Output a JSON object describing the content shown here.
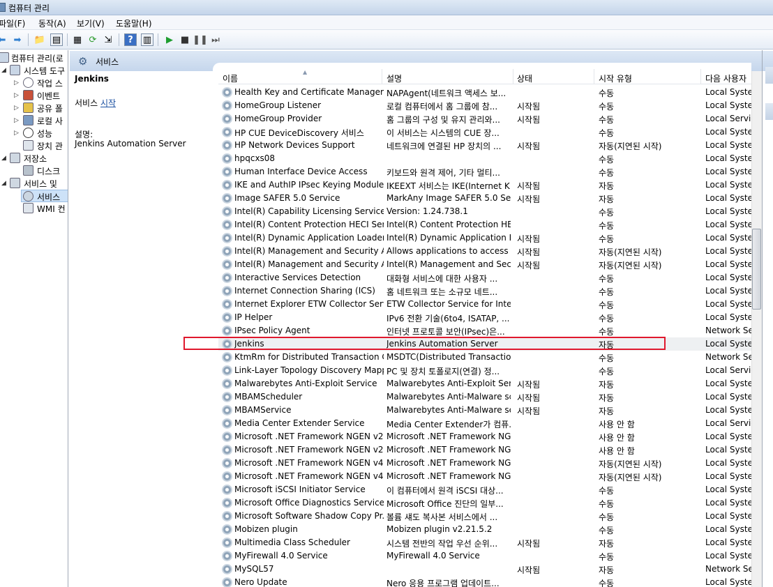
{
  "window": {
    "title": "컴퓨터 관리"
  },
  "menu": [
    "파일(F)",
    "동작(A)",
    "보기(V)",
    "도움말(H)"
  ],
  "tree": [
    {
      "label": "컴퓨터 관리(로",
      "icon": "computer-icon",
      "expanded": true
    },
    {
      "label": "시스템 도구",
      "icon": "tools-icon",
      "expanded": true
    },
    {
      "label": "작업 스",
      "icon": "clock-icon"
    },
    {
      "label": "이벤트",
      "icon": "event-viewer-icon"
    },
    {
      "label": "공유 폴",
      "icon": "shared-folder-icon"
    },
    {
      "label": "로컬 사",
      "icon": "users-icon"
    },
    {
      "label": "성능",
      "icon": "performance-icon"
    },
    {
      "label": "장치 관",
      "icon": "device-manager-icon"
    },
    {
      "label": "저장소",
      "icon": "storage-icon",
      "expanded": true
    },
    {
      "label": "디스크",
      "icon": "disk-icon"
    },
    {
      "label": "서비스 및 ",
      "icon": "services-apps-icon",
      "expanded": true
    },
    {
      "label": "서비스",
      "icon": "gear-icon",
      "selected": true
    },
    {
      "label": "WMI 컨",
      "icon": "wmi-icon"
    }
  ],
  "panel": {
    "title": "서비스"
  },
  "extended": {
    "service_name": "Jenkins",
    "action_prefix": "서비스 ",
    "action_link": "시작",
    "desc_label": "설명:",
    "description": "Jenkins Automation Server"
  },
  "columns": [
    "이름",
    "설명",
    "상태",
    "시작 유형",
    "다음 사용자"
  ],
  "services": [
    [
      "Health Key and Certificate Managem...",
      "NAPAgent(네트워크 액세스 보...",
      "",
      "수동",
      "Local Syster"
    ],
    [
      "HomeGroup Listener",
      "로컬 컴퓨터에서 홈 그룹에 참...",
      "시작됨",
      "수동",
      "Local Syster"
    ],
    [
      "HomeGroup Provider",
      "홈 그룹의 구성 및 유지 관리와...",
      "시작됨",
      "수동",
      "Local Servic"
    ],
    [
      "HP CUE DeviceDiscovery 서비스",
      "이 서비스는 시스템의 CUE 장...",
      "",
      "수동",
      "Local Syster"
    ],
    [
      "HP Network Devices Support",
      "네트워크에 연결된 HP 장치의 ...",
      "시작됨",
      "자동(지연된 시작)",
      "Local Syster"
    ],
    [
      "hpqcxs08",
      "",
      "",
      "수동",
      "Local Syster"
    ],
    [
      "Human Interface Device Access",
      "키보드와 원격 제어, 기타 멀티...",
      "",
      "수동",
      "Local Syster"
    ],
    [
      "IKE and AuthIP IPsec Keying Modules",
      "IKEEXT 서비스는 IKE(Internet K...",
      "시작됨",
      "자동",
      "Local Syster"
    ],
    [
      "Image SAFER 5.0 Service",
      "MarkAny Image SAFER 5.0 Ses...",
      "시작됨",
      "자동",
      "Local Syster"
    ],
    [
      "Intel(R) Capability Licensing Service I...",
      "Version: 1.24.738.1",
      "",
      "수동",
      "Local Syster"
    ],
    [
      "Intel(R) Content Protection HECI Serv...",
      "Intel(R) Content Protection HE...",
      "",
      "수동",
      "Local Syster"
    ],
    [
      "Intel(R) Dynamic Application Loader ...",
      "Intel(R) Dynamic Application L...",
      "시작됨",
      "수동",
      "Local Syster"
    ],
    [
      "Intel(R) Management and Security A...",
      "Allows applications to access t...",
      "시작됨",
      "자동(지연된 시작)",
      "Local Syster"
    ],
    [
      "Intel(R) Management and Security A...",
      "Intel(R) Management and Sec...",
      "시작됨",
      "자동(지연된 시작)",
      "Local Syster"
    ],
    [
      "Interactive Services Detection",
      "대화형 서비스에 대한 사용자 ...",
      "",
      "수동",
      "Local Syster"
    ],
    [
      "Internet Connection Sharing (ICS)",
      "홈 네트워크 또는 소규모 네트...",
      "",
      "수동",
      "Local Syster"
    ],
    [
      "Internet Explorer ETW Collector Service",
      "ETW Collector Service for Inter...",
      "",
      "수동",
      "Local Syster"
    ],
    [
      "IP Helper",
      "IPv6 전환 기술(6to4, ISATAP, ...",
      "",
      "수동",
      "Local Syster"
    ],
    [
      "IPsec Policy Agent",
      "인터넷 프로토콜 보안(IPsec)은...",
      "",
      "수동",
      "Network Se"
    ],
    [
      "Jenkins",
      "Jenkins Automation Server",
      "",
      "자동",
      "Local Syster"
    ],
    [
      "KtmRm for Distributed Transaction C...",
      "MSDTC(Distributed Transactio...",
      "",
      "수동",
      "Network Se"
    ],
    [
      "Link-Layer Topology Discovery Mapper",
      "PC 및 장치 토폴로지(연결) 정...",
      "",
      "수동",
      "Local Servic"
    ],
    [
      "Malwarebytes Anti-Exploit Service",
      "Malwarebytes Anti-Exploit Ser...",
      "시작됨",
      "자동",
      "Local Syster"
    ],
    [
      "MBAMScheduler",
      "Malwarebytes Anti-Malware sc...",
      "시작됨",
      "자동",
      "Local Syster"
    ],
    [
      "MBAMService",
      "Malwarebytes Anti-Malware se...",
      "시작됨",
      "자동",
      "Local Syster"
    ],
    [
      "Media Center Extender Service",
      "Media Center Extender가 컴퓨...",
      "",
      "사용 안 함",
      "Local Servic"
    ],
    [
      "Microsoft .NET Framework NGEN v2....",
      "Microsoft .NET Framework NG...",
      "",
      "사용 안 함",
      "Local Syster"
    ],
    [
      "Microsoft .NET Framework NGEN v2....",
      "Microsoft .NET Framework NG...",
      "",
      "사용 안 함",
      "Local Syster"
    ],
    [
      "Microsoft .NET Framework NGEN v4....",
      "Microsoft .NET Framework NG...",
      "",
      "자동(지연된 시작)",
      "Local Syster"
    ],
    [
      "Microsoft .NET Framework NGEN v4....",
      "Microsoft .NET Framework NG...",
      "",
      "자동(지연된 시작)",
      "Local Syster"
    ],
    [
      "Microsoft iSCSI Initiator Service",
      "이 컴퓨터에서 원격 iSCSI 대상...",
      "",
      "수동",
      "Local Syster"
    ],
    [
      "Microsoft Office Diagnostics Service",
      "Microsoft Office 진단의 일부...",
      "",
      "수동",
      "Local Syster"
    ],
    [
      "Microsoft Software Shadow Copy Pr...",
      "볼륨 섀도 복사본 서비스에서 ...",
      "",
      "수동",
      "Local Syster"
    ],
    [
      "Mobizen plugin",
      "Mobizen plugin v2.21.5.2",
      "",
      "수동",
      "Local Syster"
    ],
    [
      "Multimedia Class Scheduler",
      "시스템 전반의 작업 우선 순위...",
      "시작됨",
      "자동",
      "Local Syster"
    ],
    [
      "MyFirewall 4.0 Service",
      "MyFirewall 4.0 Service",
      "",
      "수동",
      "Local Syster"
    ],
    [
      "MySQL57",
      "",
      "시작됨",
      "자동",
      "Network Se"
    ],
    [
      "Nero Update",
      "Nero 응용 프로그램 업데이트...",
      "",
      "수동",
      "Local Syster"
    ]
  ],
  "highlighted_service": "Jenkins",
  "colors": {
    "highlight_box": "#e0182d",
    "link": "#1a4fa0",
    "header_band": "#c5d6ec"
  }
}
